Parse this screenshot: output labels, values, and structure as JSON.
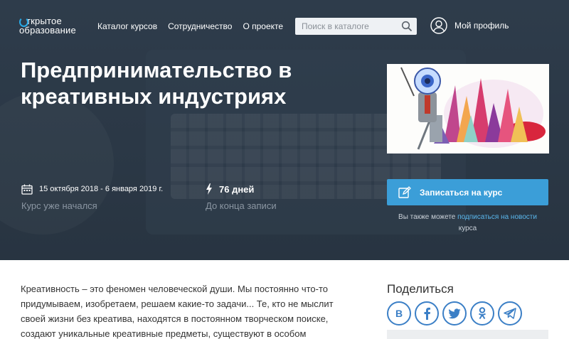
{
  "header": {
    "logo_line1": "ткрытое",
    "logo_line2": "образование",
    "nav": [
      "Каталог курсов",
      "Сотрудничество",
      "О проекте"
    ],
    "search_placeholder": "Поиск в каталоге",
    "profile_label": "Мой профиль"
  },
  "course": {
    "title": "Предпринимательство в креативных индустриях",
    "dates": "15 октября 2018 - 6 января 2019 г.",
    "status": "Курс уже начался",
    "days_left": "76 дней",
    "days_left_caption": "До конца записи",
    "enroll_label": "Записаться на курс",
    "also_text": "Вы также можете",
    "also_link": "подписаться на новости",
    "also_tail": "курса"
  },
  "description": "Креативность – это феномен человеческой души. Мы постоянно что-то придумываем, изобретаем, решаем какие-то задачи... Те, кто не мыслит своей жизни без креатива, находятся в постоянном творческом поиске, создают уникальные креативные предметы, существуют в особом",
  "share": {
    "title": "Поделиться",
    "buttons": [
      "vk-icon",
      "facebook-icon",
      "twitter-icon",
      "odnoklassniki-icon",
      "telegram-icon"
    ]
  },
  "colors": {
    "hero_bg": "#2c3a48",
    "accent": "#3b9ed8",
    "link": "#5ab7ec",
    "share": "#3b7fc6"
  }
}
